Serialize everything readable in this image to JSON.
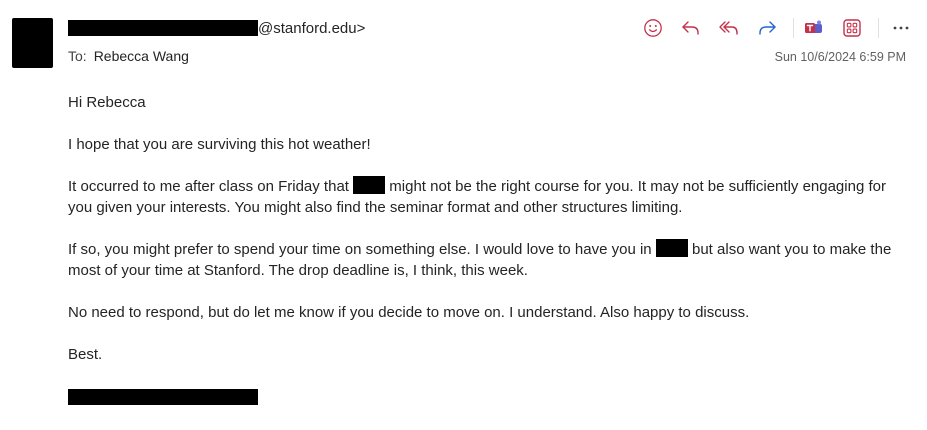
{
  "header": {
    "from_suffix": "@stanford.edu>",
    "to_label": "To:",
    "to_name": "Rebecca Wang",
    "date": "Sun 10/6/2024 6:59 PM"
  },
  "toolbar": {
    "icons": [
      "emoji-icon",
      "reply-icon",
      "reply-all-icon",
      "forward-icon",
      "teams-icon",
      "apps-icon",
      "more-icon"
    ],
    "accent_color": "#c4314b",
    "forward_color": "#2564cf"
  },
  "message": {
    "greeting": "Hi Rebecca",
    "p1": "I hope that you are surviving this hot weather!",
    "p2_a": "It occurred to me after class on Friday that",
    "p2_b": "might not be the right course for you. It may not be sufficiently engaging for you given your interests. You might also find the seminar format and other structures limiting.",
    "p3_a": "If so, you might prefer to spend your time on something else. I would love to have you in",
    "p3_b": "but also want you to make the most of your time at Stanford. The drop deadline is, I think, this week.",
    "p4": "No need to respond, but do let me know if you decide to move on. I understand. Also happy to discuss.",
    "closing": "Best."
  }
}
